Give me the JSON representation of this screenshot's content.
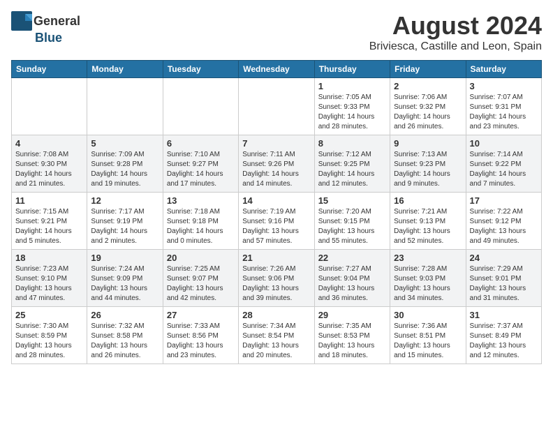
{
  "header": {
    "logo_general": "General",
    "logo_blue": "Blue",
    "title": "August 2024",
    "location": "Briviesca, Castille and Leon, Spain"
  },
  "weekdays": [
    "Sunday",
    "Monday",
    "Tuesday",
    "Wednesday",
    "Thursday",
    "Friday",
    "Saturday"
  ],
  "weeks": [
    [
      {
        "day": "",
        "info": ""
      },
      {
        "day": "",
        "info": ""
      },
      {
        "day": "",
        "info": ""
      },
      {
        "day": "",
        "info": ""
      },
      {
        "day": "1",
        "info": "Sunrise: 7:05 AM\nSunset: 9:33 PM\nDaylight: 14 hours and 28 minutes."
      },
      {
        "day": "2",
        "info": "Sunrise: 7:06 AM\nSunset: 9:32 PM\nDaylight: 14 hours and 26 minutes."
      },
      {
        "day": "3",
        "info": "Sunrise: 7:07 AM\nSunset: 9:31 PM\nDaylight: 14 hours and 23 minutes."
      }
    ],
    [
      {
        "day": "4",
        "info": "Sunrise: 7:08 AM\nSunset: 9:30 PM\nDaylight: 14 hours and 21 minutes."
      },
      {
        "day": "5",
        "info": "Sunrise: 7:09 AM\nSunset: 9:28 PM\nDaylight: 14 hours and 19 minutes."
      },
      {
        "day": "6",
        "info": "Sunrise: 7:10 AM\nSunset: 9:27 PM\nDaylight: 14 hours and 17 minutes."
      },
      {
        "day": "7",
        "info": "Sunrise: 7:11 AM\nSunset: 9:26 PM\nDaylight: 14 hours and 14 minutes."
      },
      {
        "day": "8",
        "info": "Sunrise: 7:12 AM\nSunset: 9:25 PM\nDaylight: 14 hours and 12 minutes."
      },
      {
        "day": "9",
        "info": "Sunrise: 7:13 AM\nSunset: 9:23 PM\nDaylight: 14 hours and 9 minutes."
      },
      {
        "day": "10",
        "info": "Sunrise: 7:14 AM\nSunset: 9:22 PM\nDaylight: 14 hours and 7 minutes."
      }
    ],
    [
      {
        "day": "11",
        "info": "Sunrise: 7:15 AM\nSunset: 9:21 PM\nDaylight: 14 hours and 5 minutes."
      },
      {
        "day": "12",
        "info": "Sunrise: 7:17 AM\nSunset: 9:19 PM\nDaylight: 14 hours and 2 minutes."
      },
      {
        "day": "13",
        "info": "Sunrise: 7:18 AM\nSunset: 9:18 PM\nDaylight: 14 hours and 0 minutes."
      },
      {
        "day": "14",
        "info": "Sunrise: 7:19 AM\nSunset: 9:16 PM\nDaylight: 13 hours and 57 minutes."
      },
      {
        "day": "15",
        "info": "Sunrise: 7:20 AM\nSunset: 9:15 PM\nDaylight: 13 hours and 55 minutes."
      },
      {
        "day": "16",
        "info": "Sunrise: 7:21 AM\nSunset: 9:13 PM\nDaylight: 13 hours and 52 minutes."
      },
      {
        "day": "17",
        "info": "Sunrise: 7:22 AM\nSunset: 9:12 PM\nDaylight: 13 hours and 49 minutes."
      }
    ],
    [
      {
        "day": "18",
        "info": "Sunrise: 7:23 AM\nSunset: 9:10 PM\nDaylight: 13 hours and 47 minutes."
      },
      {
        "day": "19",
        "info": "Sunrise: 7:24 AM\nSunset: 9:09 PM\nDaylight: 13 hours and 44 minutes."
      },
      {
        "day": "20",
        "info": "Sunrise: 7:25 AM\nSunset: 9:07 PM\nDaylight: 13 hours and 42 minutes."
      },
      {
        "day": "21",
        "info": "Sunrise: 7:26 AM\nSunset: 9:06 PM\nDaylight: 13 hours and 39 minutes."
      },
      {
        "day": "22",
        "info": "Sunrise: 7:27 AM\nSunset: 9:04 PM\nDaylight: 13 hours and 36 minutes."
      },
      {
        "day": "23",
        "info": "Sunrise: 7:28 AM\nSunset: 9:03 PM\nDaylight: 13 hours and 34 minutes."
      },
      {
        "day": "24",
        "info": "Sunrise: 7:29 AM\nSunset: 9:01 PM\nDaylight: 13 hours and 31 minutes."
      }
    ],
    [
      {
        "day": "25",
        "info": "Sunrise: 7:30 AM\nSunset: 8:59 PM\nDaylight: 13 hours and 28 minutes."
      },
      {
        "day": "26",
        "info": "Sunrise: 7:32 AM\nSunset: 8:58 PM\nDaylight: 13 hours and 26 minutes."
      },
      {
        "day": "27",
        "info": "Sunrise: 7:33 AM\nSunset: 8:56 PM\nDaylight: 13 hours and 23 minutes."
      },
      {
        "day": "28",
        "info": "Sunrise: 7:34 AM\nSunset: 8:54 PM\nDaylight: 13 hours and 20 minutes."
      },
      {
        "day": "29",
        "info": "Sunrise: 7:35 AM\nSunset: 8:53 PM\nDaylight: 13 hours and 18 minutes."
      },
      {
        "day": "30",
        "info": "Sunrise: 7:36 AM\nSunset: 8:51 PM\nDaylight: 13 hours and 15 minutes."
      },
      {
        "day": "31",
        "info": "Sunrise: 7:37 AM\nSunset: 8:49 PM\nDaylight: 13 hours and 12 minutes."
      }
    ]
  ]
}
